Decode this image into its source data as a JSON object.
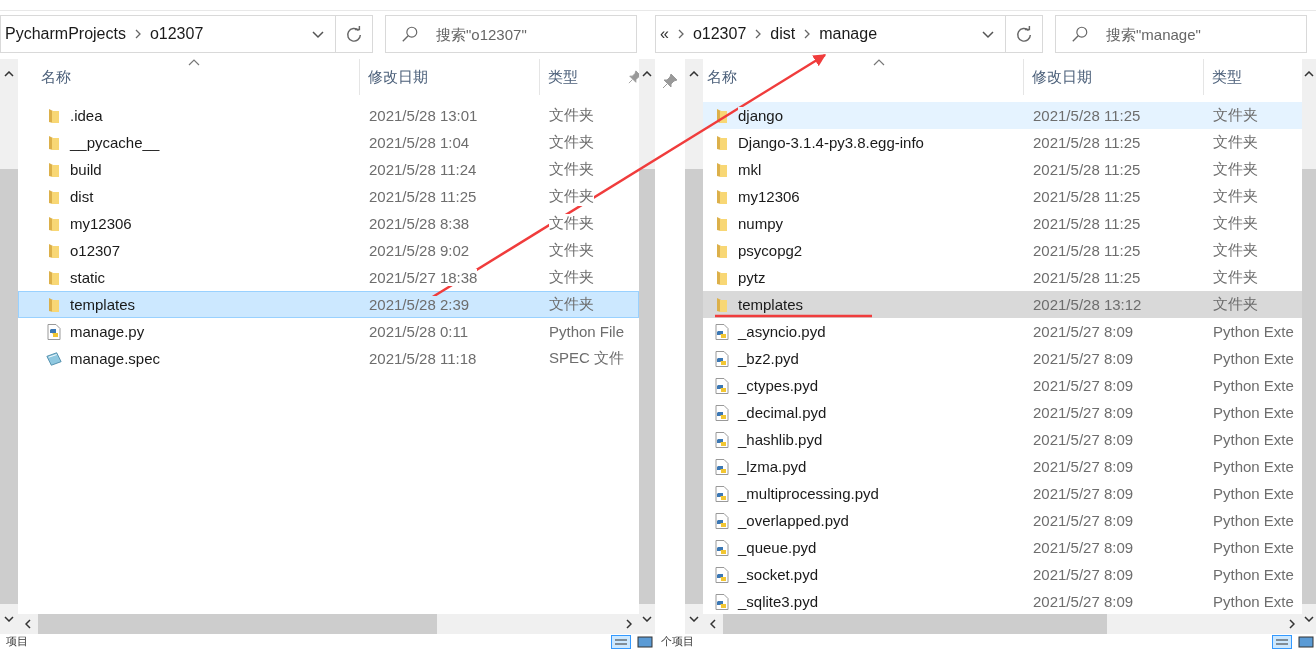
{
  "windows": [
    {
      "focused": true,
      "breadcrumbs": [
        "PycharmProjects",
        "o12307"
      ],
      "search": {
        "placeholder": "搜索\"o12307\""
      },
      "columns": [
        "名称",
        "修改日期",
        "类型"
      ],
      "rows": [
        {
          "kind": "folder",
          "name": ".idea",
          "date": "2021/5/28 13:01",
          "type": "文件夹",
          "selected": false,
          "hovered": false
        },
        {
          "kind": "folder",
          "name": "__pycache__",
          "date": "2021/5/28 1:04",
          "type": "文件夹",
          "selected": false,
          "hovered": false
        },
        {
          "kind": "folder",
          "name": "build",
          "date": "2021/5/28 11:24",
          "type": "文件夹",
          "selected": false,
          "hovered": false
        },
        {
          "kind": "folder",
          "name": "dist",
          "date": "2021/5/28 11:25",
          "type": "文件夹",
          "selected": false,
          "hovered": false
        },
        {
          "kind": "folder",
          "name": "my12306",
          "date": "2021/5/28 8:38",
          "type": "文件夹",
          "selected": false,
          "hovered": false
        },
        {
          "kind": "folder",
          "name": "o12307",
          "date": "2021/5/28 9:02",
          "type": "文件夹",
          "selected": false,
          "hovered": false
        },
        {
          "kind": "folder",
          "name": "static",
          "date": "2021/5/27 18:38",
          "type": "文件夹",
          "selected": false,
          "hovered": false
        },
        {
          "kind": "folder",
          "name": "templates",
          "date": "2021/5/28 2:39",
          "type": "文件夹",
          "selected": true,
          "hovered": false
        },
        {
          "kind": "py",
          "name": "manage.py",
          "date": "2021/5/28 0:11",
          "type": "Python File",
          "selected": false,
          "hovered": false
        },
        {
          "kind": "spec",
          "name": "manage.spec",
          "date": "2021/5/28 11:18",
          "type": "SPEC 文件",
          "selected": false,
          "hovered": false
        }
      ],
      "status": "项目"
    },
    {
      "focused": false,
      "overflow": "«",
      "breadcrumbs": [
        "o12307",
        "dist",
        "manage"
      ],
      "search": {
        "placeholder": "搜索\"manage\""
      },
      "columns": [
        "名称",
        "修改日期",
        "类型"
      ],
      "rows": [
        {
          "kind": "folder",
          "name": "django",
          "date": "2021/5/28 11:25",
          "type": "文件夹",
          "selected": false,
          "hovered": true
        },
        {
          "kind": "folder",
          "name": "Django-3.1.4-py3.8.egg-info",
          "date": "2021/5/28 11:25",
          "type": "文件夹",
          "selected": false,
          "hovered": false
        },
        {
          "kind": "folder",
          "name": "mkl",
          "date": "2021/5/28 11:25",
          "type": "文件夹",
          "selected": false,
          "hovered": false
        },
        {
          "kind": "folder",
          "name": "my12306",
          "date": "2021/5/28 11:25",
          "type": "文件夹",
          "selected": false,
          "hovered": false
        },
        {
          "kind": "folder",
          "name": "numpy",
          "date": "2021/5/28 11:25",
          "type": "文件夹",
          "selected": false,
          "hovered": false
        },
        {
          "kind": "folder",
          "name": "psycopg2",
          "date": "2021/5/28 11:25",
          "type": "文件夹",
          "selected": false,
          "hovered": false
        },
        {
          "kind": "folder",
          "name": "pytz",
          "date": "2021/5/28 11:25",
          "type": "文件夹",
          "selected": false,
          "hovered": false
        },
        {
          "kind": "folder",
          "name": "templates",
          "date": "2021/5/28 13:12",
          "type": "文件夹",
          "selected": true,
          "hovered": false
        },
        {
          "kind": "pyd",
          "name": "_asyncio.pyd",
          "date": "2021/5/27 8:09",
          "type": "Python Exte",
          "selected": false,
          "hovered": false
        },
        {
          "kind": "pyd",
          "name": "_bz2.pyd",
          "date": "2021/5/27 8:09",
          "type": "Python Exte",
          "selected": false,
          "hovered": false
        },
        {
          "kind": "pyd",
          "name": "_ctypes.pyd",
          "date": "2021/5/27 8:09",
          "type": "Python Exte",
          "selected": false,
          "hovered": false
        },
        {
          "kind": "pyd",
          "name": "_decimal.pyd",
          "date": "2021/5/27 8:09",
          "type": "Python Exte",
          "selected": false,
          "hovered": false
        },
        {
          "kind": "pyd",
          "name": "_hashlib.pyd",
          "date": "2021/5/27 8:09",
          "type": "Python Exte",
          "selected": false,
          "hovered": false
        },
        {
          "kind": "pyd",
          "name": "_lzma.pyd",
          "date": "2021/5/27 8:09",
          "type": "Python Exte",
          "selected": false,
          "hovered": false
        },
        {
          "kind": "pyd",
          "name": "_multiprocessing.pyd",
          "date": "2021/5/27 8:09",
          "type": "Python Exte",
          "selected": false,
          "hovered": false
        },
        {
          "kind": "pyd",
          "name": "_overlapped.pyd",
          "date": "2021/5/27 8:09",
          "type": "Python Exte",
          "selected": false,
          "hovered": false
        },
        {
          "kind": "pyd",
          "name": "_queue.pyd",
          "date": "2021/5/27 8:09",
          "type": "Python Exte",
          "selected": false,
          "hovered": false
        },
        {
          "kind": "pyd",
          "name": "_socket.pyd",
          "date": "2021/5/27 8:09",
          "type": "Python Exte",
          "selected": false,
          "hovered": false
        },
        {
          "kind": "pyd",
          "name": "_sqlite3.pyd",
          "date": "2021/5/27 8:09",
          "type": "Python Exte",
          "selected": false,
          "hovered": false
        }
      ],
      "status": "个项目"
    }
  ]
}
